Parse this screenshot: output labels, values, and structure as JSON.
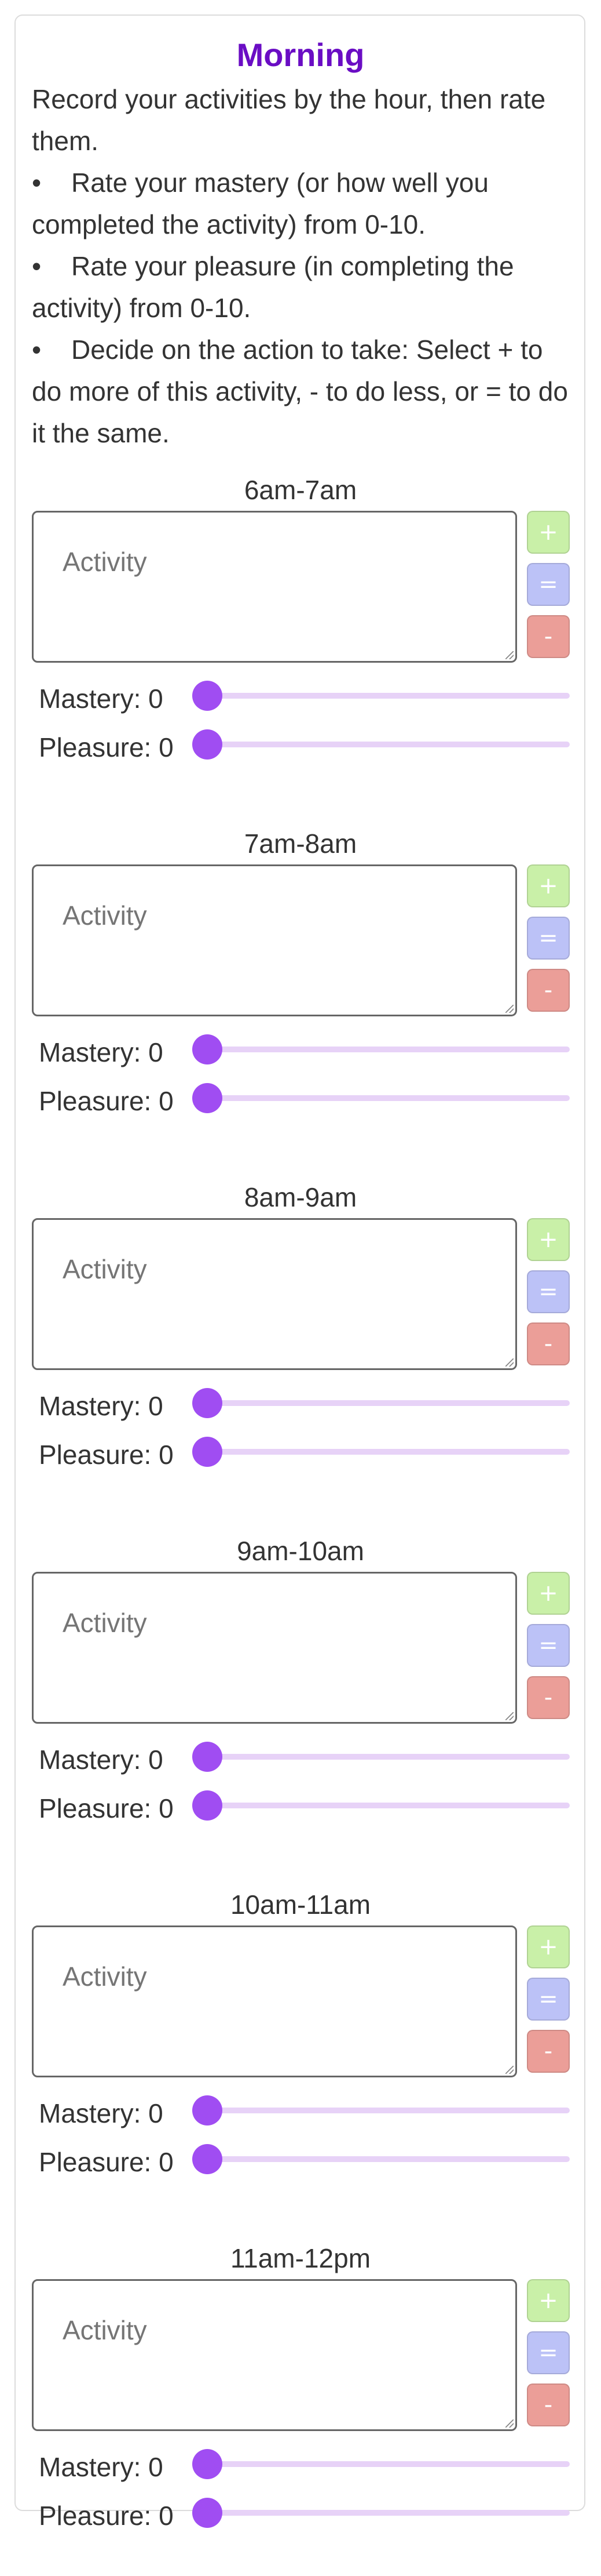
{
  "title": "Morning",
  "intro": "Record your activities by the hour, then rate them.",
  "rules": [
    "Rate your mastery (or how well you completed the activity) from 0-10.",
    "Rate your pleasure (in completing the activity) from 0-10.",
    "Decide on the action to take: Select + to do more of this activity, - to do less, or = to do it the same."
  ],
  "activity_placeholder": "Activity",
  "buttons": {
    "plus": "+",
    "equal": "=",
    "minus": "-"
  },
  "colors": {
    "title": "#6a0dc4",
    "plus": "#c9f0a8",
    "equal": "#bcc2f7",
    "minus": "#eb9e98",
    "slider_thumb": "#a04df2",
    "slider_track": "#e7d2f7"
  },
  "slots": [
    {
      "label": "6am-7am",
      "mastery_label": "Mastery: 0",
      "pleasure_label": "Pleasure: 0",
      "mastery": 0,
      "pleasure": 0
    },
    {
      "label": "7am-8am",
      "mastery_label": "Mastery: 0",
      "pleasure_label": "Pleasure: 0",
      "mastery": 0,
      "pleasure": 0
    },
    {
      "label": "8am-9am",
      "mastery_label": "Mastery: 0",
      "pleasure_label": "Pleasure: 0",
      "mastery": 0,
      "pleasure": 0
    },
    {
      "label": "9am-10am",
      "mastery_label": "Mastery: 0",
      "pleasure_label": "Pleasure: 0",
      "mastery": 0,
      "pleasure": 0
    },
    {
      "label": "10am-11am",
      "mastery_label": "Mastery: 0",
      "pleasure_label": "Pleasure: 0",
      "mastery": 0,
      "pleasure": 0
    },
    {
      "label": "11am-12pm",
      "mastery_label": "Mastery: 0",
      "pleasure_label": "Pleasure: 0",
      "mastery": 0,
      "pleasure": 0
    }
  ]
}
